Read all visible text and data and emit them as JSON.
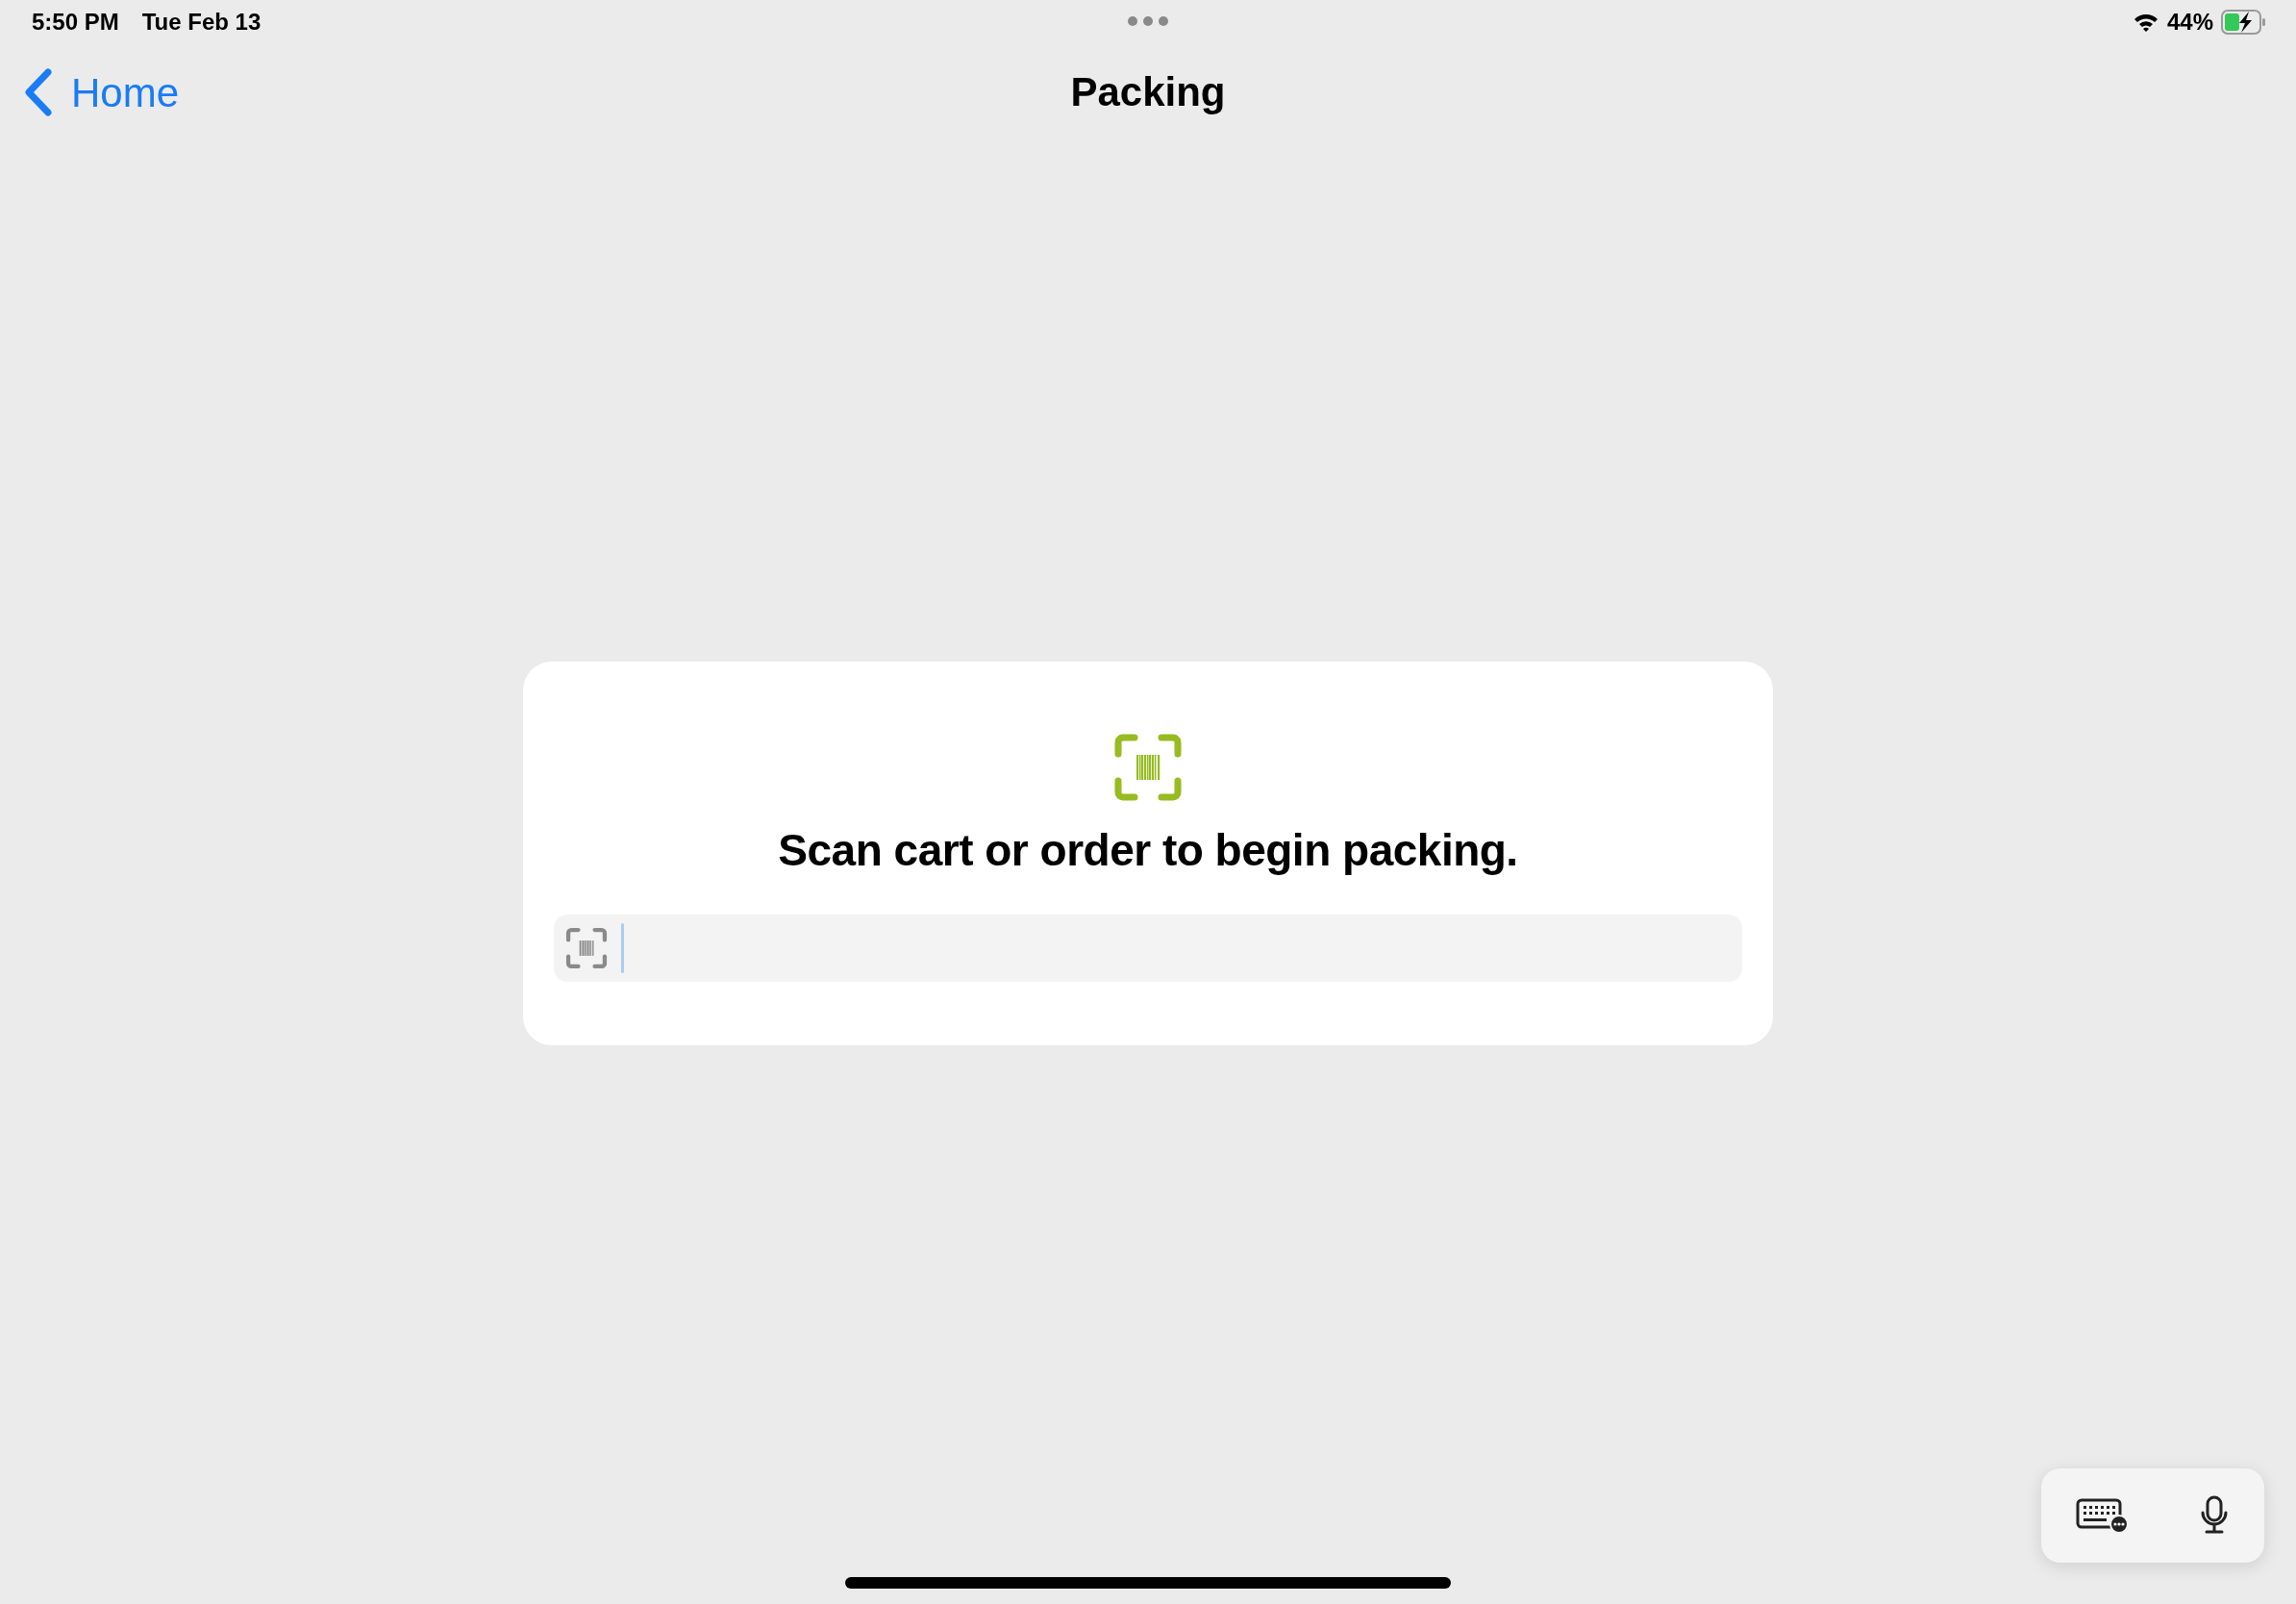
{
  "status_bar": {
    "time": "5:50 PM",
    "date": "Tue Feb 13",
    "battery_percent": "44%",
    "battery": {
      "charging": true
    }
  },
  "nav_bar": {
    "back_label": "Home",
    "title": "Packing"
  },
  "scan_card": {
    "message": "Scan cart or order to begin packing.",
    "scan_field": {
      "focused": true
    }
  },
  "keyboard_toolbar": {
    "buttons": [
      {
        "kind": "keyboard"
      },
      {
        "kind": "dictation"
      }
    ]
  }
}
